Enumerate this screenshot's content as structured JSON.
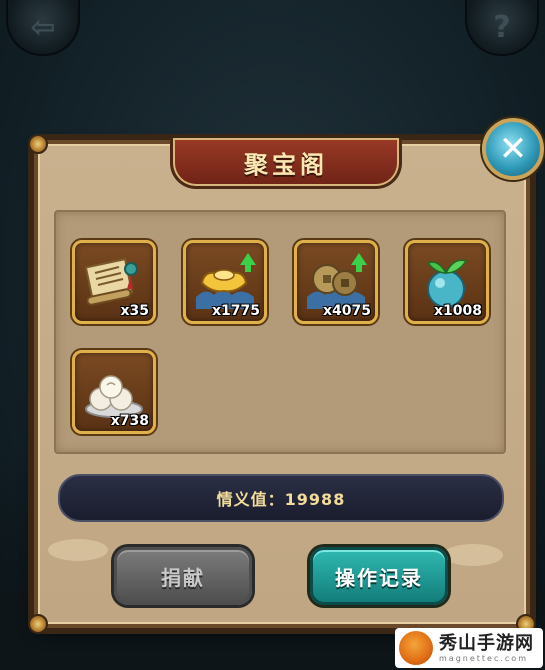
{
  "panel": {
    "title": "聚宝阁",
    "close_icon": "close-icon"
  },
  "items": [
    {
      "name": "scroll-item",
      "count": "x35",
      "upgrade": false
    },
    {
      "name": "gold-ingot-item",
      "count": "x1775",
      "upgrade": true
    },
    {
      "name": "copper-coin-item",
      "count": "x4075",
      "upgrade": true
    },
    {
      "name": "sprout-orb-item",
      "count": "x1008",
      "upgrade": false
    },
    {
      "name": "steamed-bun-item",
      "count": "x738",
      "upgrade": false
    }
  ],
  "value_bar": {
    "text": "情义值：19988"
  },
  "buttons": {
    "donate": "捐献",
    "log": "操作记录"
  },
  "watermark": {
    "main": "秀山手游网",
    "sub": "magnettec.com"
  },
  "colors": {
    "panel": "#c9b18e",
    "title_plate": "#8b3220",
    "log_button": "#1f9c96",
    "donate_button": "#666666"
  }
}
